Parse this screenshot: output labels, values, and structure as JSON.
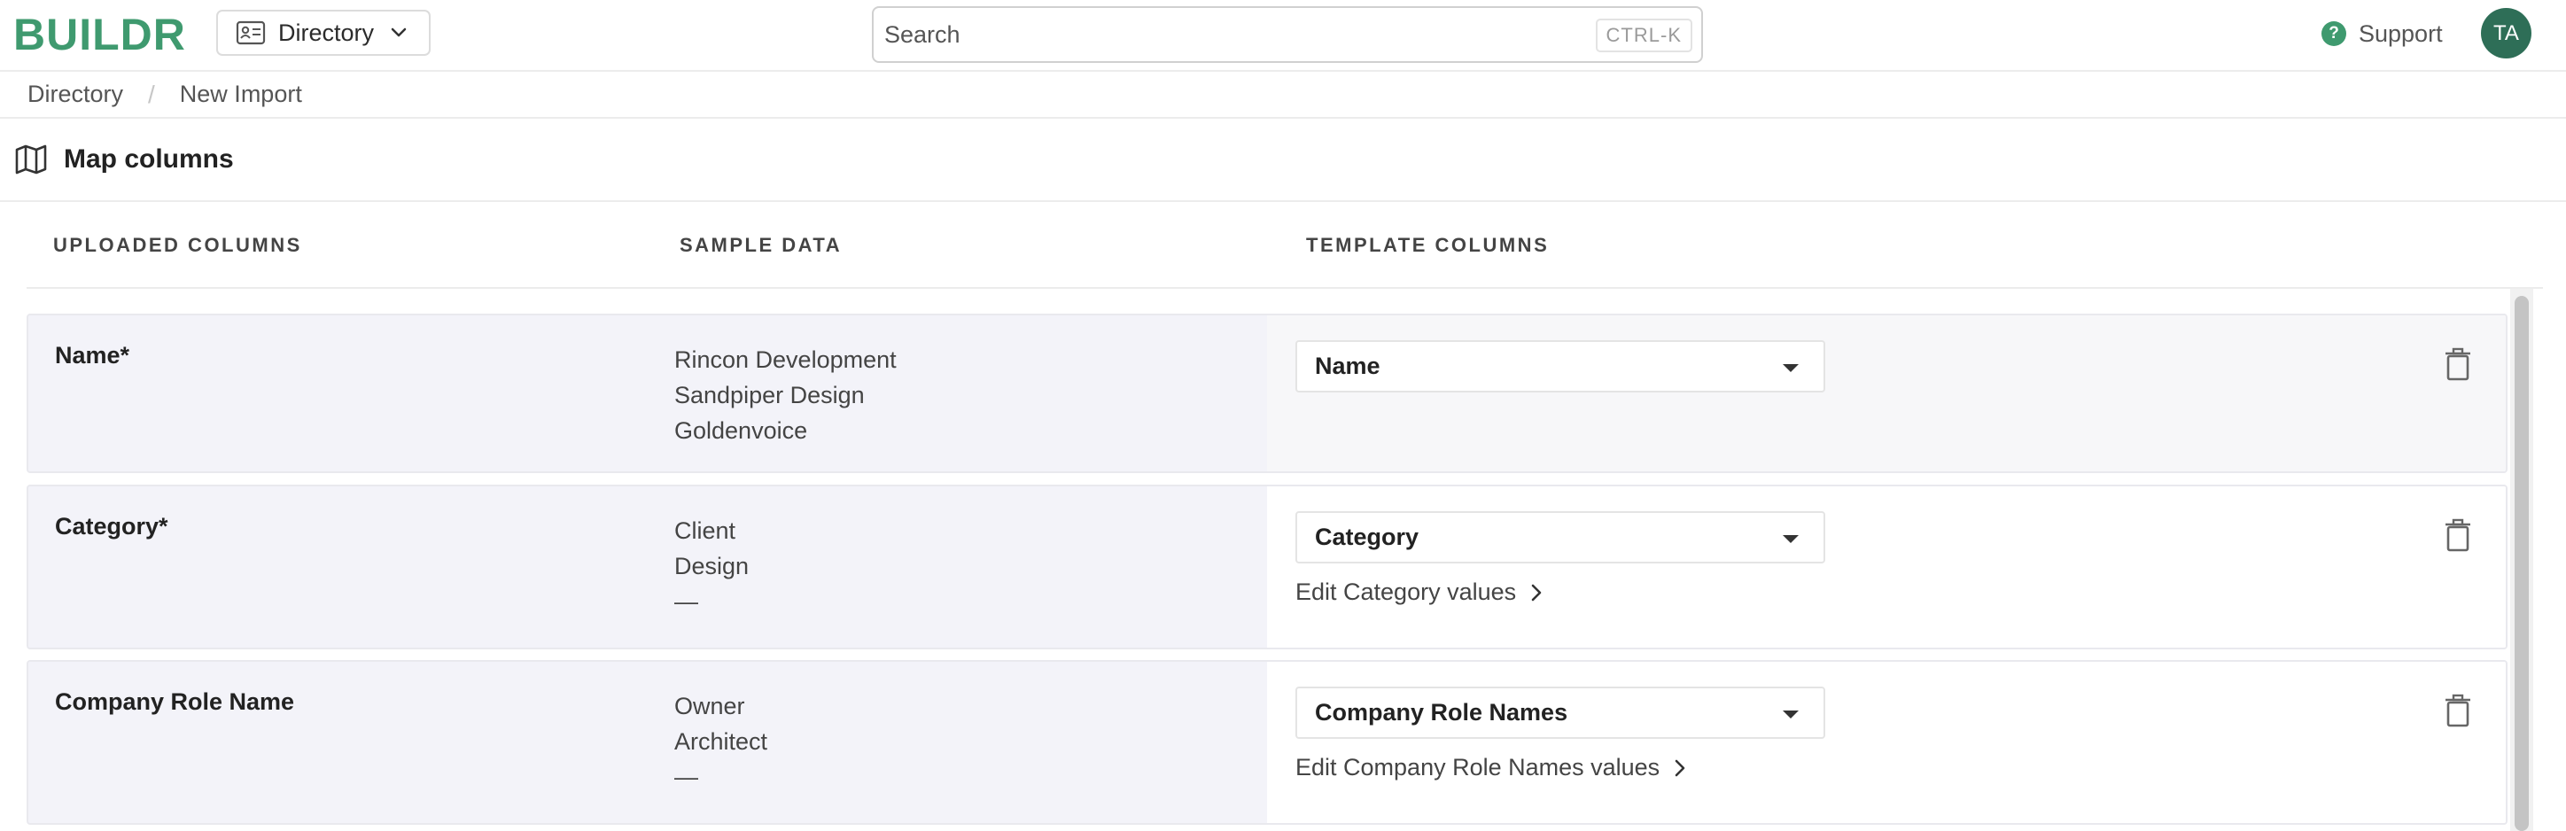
{
  "app": {
    "logo": "BUILDR",
    "tool_selector": "Directory",
    "search": {
      "placeholder": "Search",
      "shortcut": "CTRL-K"
    },
    "support_label": "Support",
    "user_initials": "TA",
    "brand_color": "#3f9a6f"
  },
  "breadcrumb": [
    {
      "label": "Directory"
    },
    {
      "label": "New Import"
    }
  ],
  "section": {
    "title": "Map columns",
    "icon": "map-icon"
  },
  "columns": {
    "uploaded": "UPLOADED COLUMNS",
    "sample": "SAMPLE DATA",
    "template": "TEMPLATE COLUMNS"
  },
  "rows": [
    {
      "uploaded": "Name*",
      "samples": [
        "Rincon Development",
        "Sandpiper Design",
        "Goldenvoice"
      ],
      "template": "Name",
      "edit_link": ""
    },
    {
      "uploaded": "Category*",
      "samples": [
        "Client",
        "Design",
        "—"
      ],
      "template": "Category",
      "edit_link": "Edit Category values"
    },
    {
      "uploaded": "Company Role Name",
      "samples": [
        "Owner",
        "Architect",
        "—"
      ],
      "template": "Company Role Names",
      "edit_link": "Edit Company Role Names values"
    }
  ]
}
